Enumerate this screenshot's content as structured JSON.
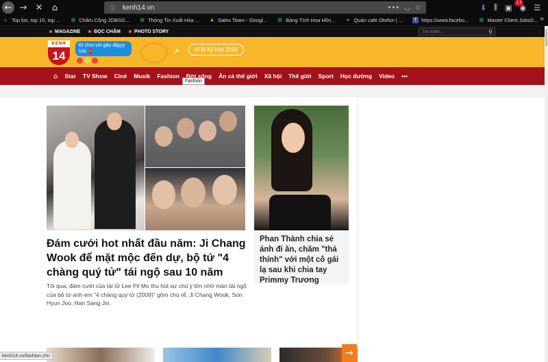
{
  "browser": {
    "url": "kenh14.vn",
    "notification_count": "17",
    "bookmarks": [
      {
        "label": "Top list, top 10, top ...",
        "color": "#c9a227",
        "glyph": "L"
      },
      {
        "label": "Chấm Công JOBSG...",
        "color": "#1f9d55",
        "glyph": "▦"
      },
      {
        "label": "Thông Tin Xuất Hóa ...",
        "color": "#1f9d55",
        "glyph": "▦"
      },
      {
        "label": "Sales Team - Googl...",
        "color": "#f4b400",
        "glyph": "▲"
      },
      {
        "label": "Bảng Tính Hoa Hồn...",
        "color": "#1f9d55",
        "glyph": "▦"
      },
      {
        "label": "Quán cafe Otofun | ...",
        "color": "#555555",
        "glyph": "●"
      },
      {
        "label": "https://www.facebo...",
        "color": "#3b5998",
        "glyph": "f"
      },
      {
        "label": "Master Client JobsG...",
        "color": "#1f9d55",
        "glyph": "▦"
      }
    ],
    "status_url": "kenh14.vn/fashion.chn"
  },
  "site": {
    "top_links": [
      "MAGAZINE",
      "ĐỌC CHẬM",
      "PHOTO STORY"
    ],
    "search_placeholder": "Tìm kiếm...",
    "logo_top": "KENH",
    "logo_number": "14",
    "promo_text": "Đi chơi với gấu đâyyy hihi 🧧",
    "hashtag": "#Tết Kỷ Hợi 2019",
    "nav": [
      "Star",
      "TV Show",
      "Ciné",
      "Musik",
      "Fashion",
      "Đời sống",
      "Ăn cả thế giới",
      "Xã hội",
      "Thế giới",
      "Sport",
      "Học đường",
      "Video",
      "•••"
    ],
    "tooltip": "Fashion",
    "main_story": {
      "title": "Đám cưới hot nhất đầu năm: Ji Chang Wook để mặt mộc đến dự, bộ tứ \"4 chàng quý tử\" tái ngộ sau 10 năm",
      "description": "Tối qua, đám cưới của tài tử Lee Pil Mo thu hút sự chú ý lớn nhờ màn tái ngộ của bộ tứ anh em \"4 chàng quý tử (2009)\" gồm chú rể, Ji Chang Wook, Son Hyun Joo, Han Sang Jin."
    },
    "side_story": {
      "title": "Phan Thành chia sẻ ảnh đi ăn, chăm \"thả thính\" với một cô gái lạ sau khi chia tay Primmy Trương"
    }
  },
  "colors": {
    "hero_bg": "#f8b62b",
    "nav_bg": "#a3121a",
    "accent": "#f07c23"
  }
}
